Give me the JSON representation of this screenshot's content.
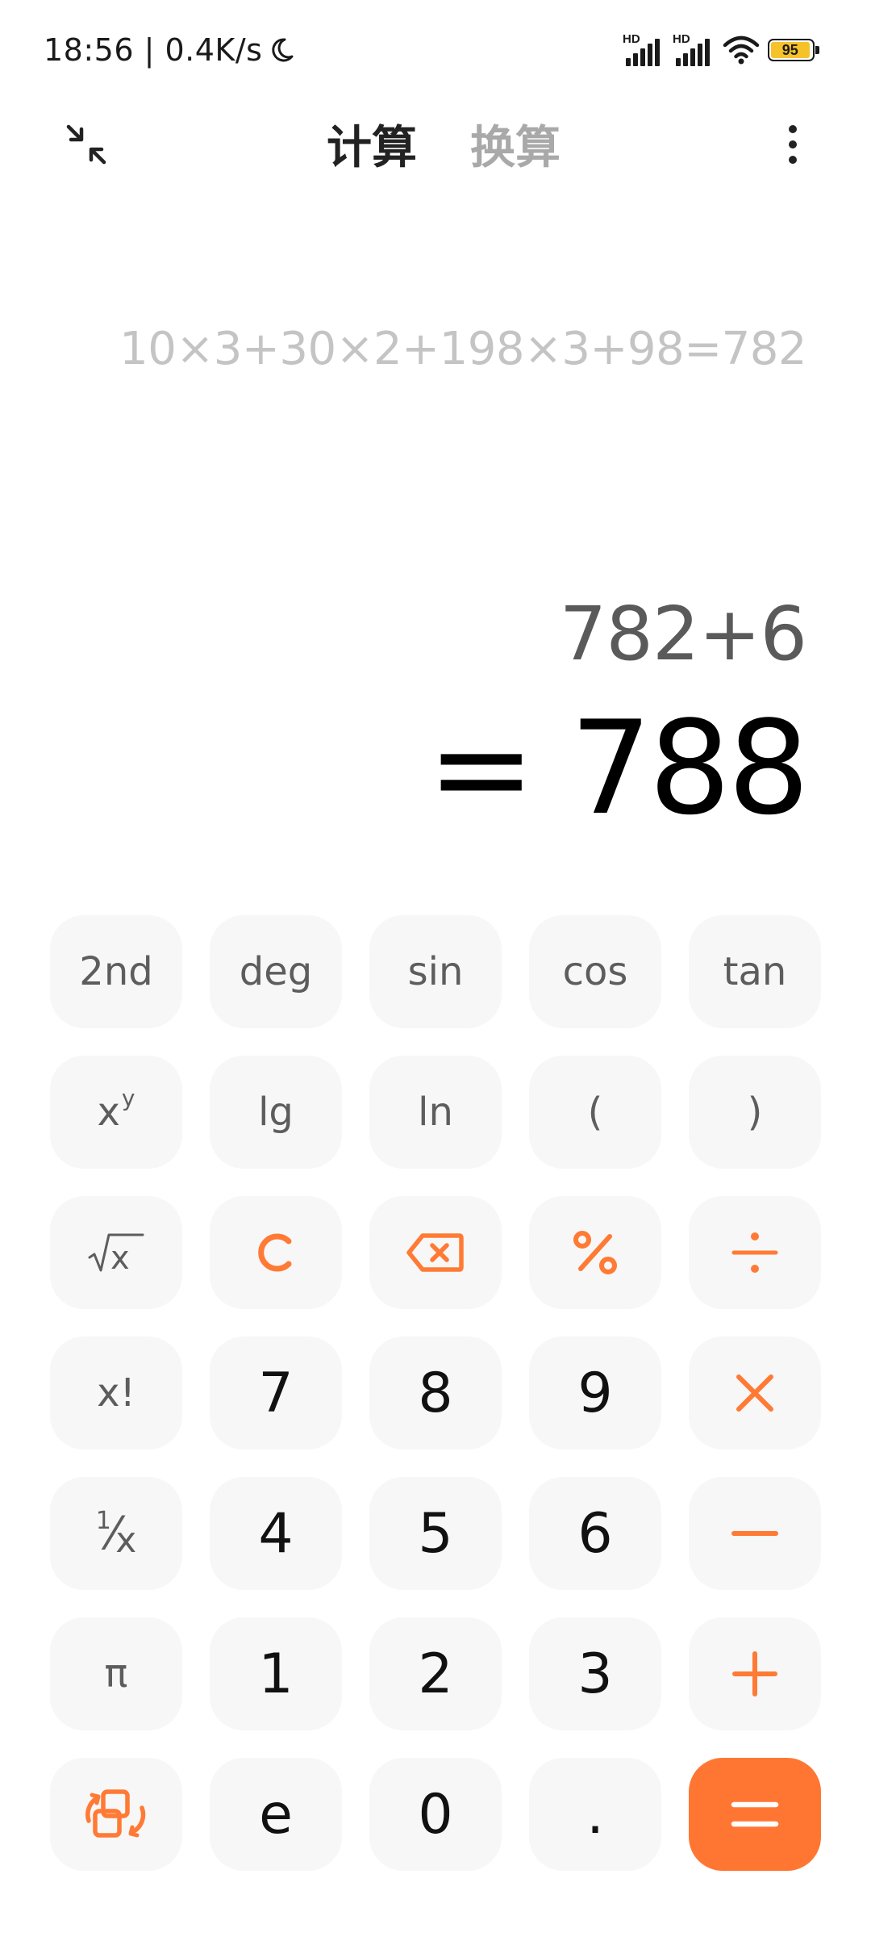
{
  "status_bar": {
    "time_speed": "18:56 | 0.4K/s",
    "moon_icon": "moon-icon",
    "signal_1_label": "HD",
    "signal_2_label": "HD",
    "battery_level": "95"
  },
  "top_bar": {
    "collapse_icon": "collapse-arrows-icon",
    "tab_calculate": "计算",
    "tab_convert": "换算",
    "more_icon": "more-vertical-icon"
  },
  "display": {
    "history": "10×3+30×2+198×3+98=782",
    "expression": "782+6",
    "result": "= 788"
  },
  "keypad": {
    "row1": [
      "2nd",
      "deg",
      "sin",
      "cos",
      "tan"
    ],
    "row2": [
      "x",
      "y",
      "lg",
      "ln",
      "(",
      ")"
    ],
    "sqrt_x": "x",
    "clear": "C",
    "percent": "%",
    "divide": "÷",
    "factorial": "x!",
    "row4": [
      "7",
      "8",
      "9"
    ],
    "multiply": "×",
    "reciprocal": {
      "num": "1",
      "slash": "⁄",
      "den": "x"
    },
    "row5": [
      "4",
      "5",
      "6"
    ],
    "minus": "−",
    "pi": "π",
    "row6": [
      "1",
      "2",
      "3"
    ],
    "plus": "+",
    "e": "e",
    "zero": "0",
    "dot": ".",
    "equals": "="
  },
  "colors": {
    "accent": "#ff7633",
    "key_background": "#f7f7f7",
    "history_text": "#c4c4c4"
  }
}
